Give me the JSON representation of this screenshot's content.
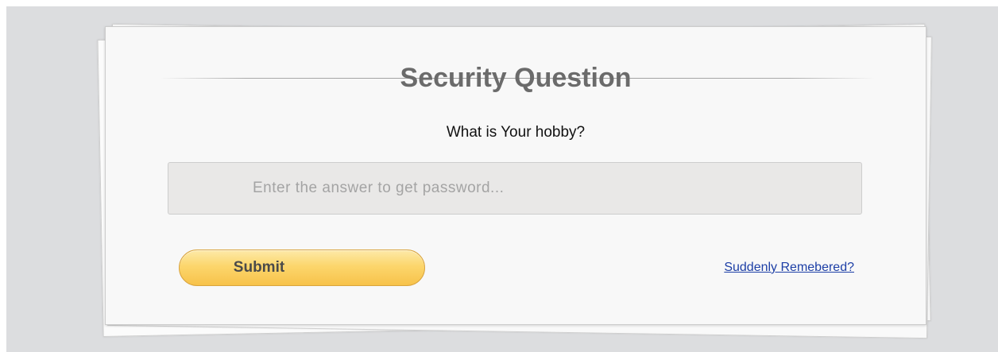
{
  "form": {
    "title": "Security Question",
    "question": "What is Your hobby?",
    "answer_placeholder": "Enter the answer to get password...",
    "answer_value": "",
    "submit_label": "Submit",
    "remembered_link": "Suddenly Remebered?"
  },
  "colors": {
    "background": "#dcdddf",
    "card": "#f8f8f8",
    "title_text": "#6b6b6b",
    "input_background": "#e9e8e7",
    "button_gradient_top": "#fde9a8",
    "button_gradient_bottom": "#f7c24a",
    "link": "#1d3fa6"
  }
}
